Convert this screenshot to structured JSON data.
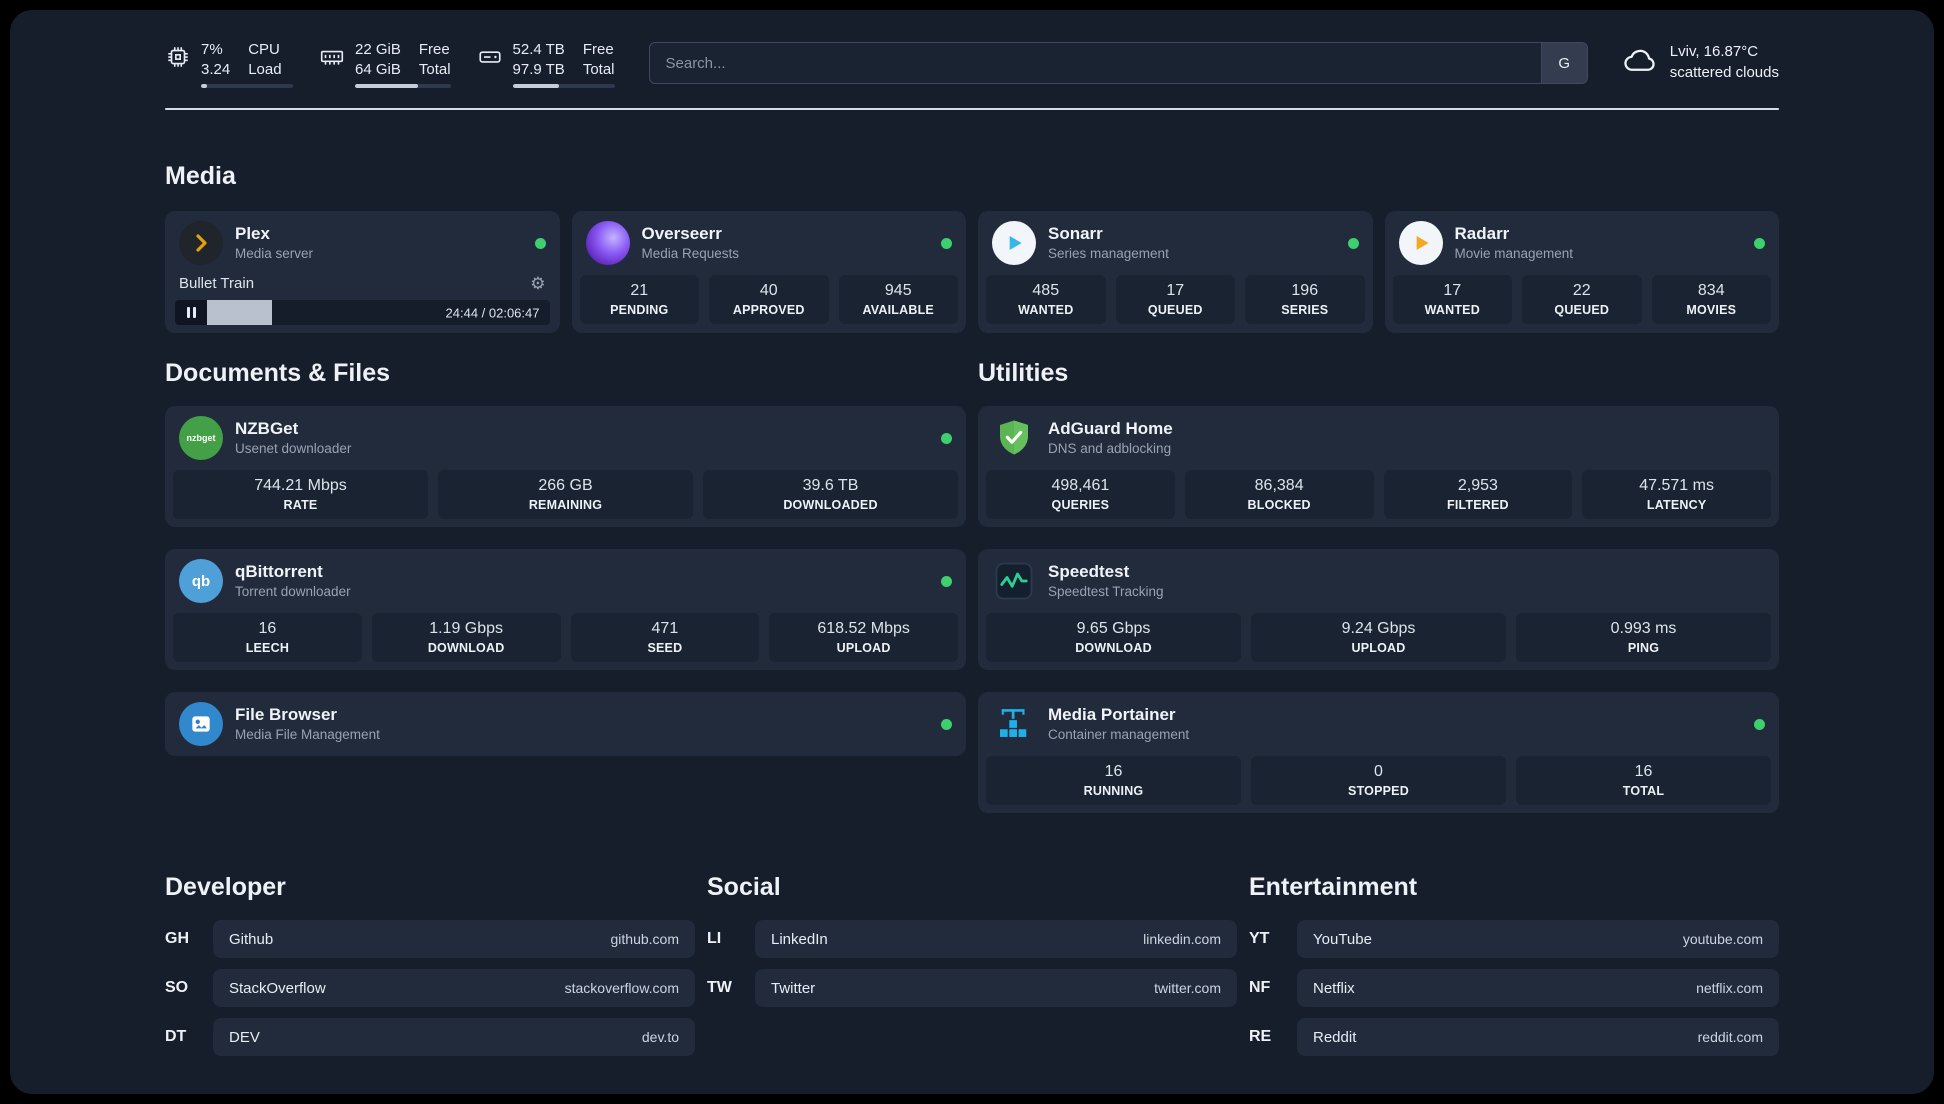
{
  "topbar": {
    "cpu": {
      "value_top": "7%",
      "value_bottom": "3.24",
      "label_top": "CPU",
      "label_bottom": "Load",
      "progress": 7
    },
    "ram": {
      "value_top": "22 GiB",
      "value_bottom": "64 GiB",
      "label_top": "Free",
      "label_bottom": "Total",
      "progress": 66
    },
    "disk": {
      "value_top": "52.4 TB",
      "value_bottom": "97.9 TB",
      "label_top": "Free",
      "label_bottom": "Total",
      "progress": 46
    },
    "search": {
      "placeholder": "Search...",
      "engine_label": "G"
    },
    "weather": {
      "location": "Lviv, 16.87°C",
      "condition": "scattered clouds"
    }
  },
  "media": {
    "title": "Media",
    "plex": {
      "name": "Plex",
      "subtitle": "Media server",
      "now_playing": "Bullet Train",
      "time": "24:44 / 02:06:47",
      "progress": 19
    },
    "overseerr": {
      "name": "Overseerr",
      "subtitle": "Media Requests",
      "stats": [
        {
          "value": "21",
          "label": "PENDING"
        },
        {
          "value": "40",
          "label": "APPROVED"
        },
        {
          "value": "945",
          "label": "AVAILABLE"
        }
      ]
    },
    "sonarr": {
      "name": "Sonarr",
      "subtitle": "Series management",
      "stats": [
        {
          "value": "485",
          "label": "WANTED"
        },
        {
          "value": "17",
          "label": "QUEUED"
        },
        {
          "value": "196",
          "label": "SERIES"
        }
      ]
    },
    "radarr": {
      "name": "Radarr",
      "subtitle": "Movie management",
      "stats": [
        {
          "value": "17",
          "label": "WANTED"
        },
        {
          "value": "22",
          "label": "QUEUED"
        },
        {
          "value": "834",
          "label": "MOVIES"
        }
      ]
    }
  },
  "documents": {
    "title": "Documents & Files",
    "nzbget": {
      "name": "NZBGet",
      "subtitle": "Usenet downloader",
      "icon_text": "nzbget",
      "stats": [
        {
          "value": "744.21 Mbps",
          "label": "RATE"
        },
        {
          "value": "266 GB",
          "label": "REMAINING"
        },
        {
          "value": "39.6 TB",
          "label": "DOWNLOADED"
        }
      ]
    },
    "qbittorrent": {
      "name": "qBittorrent",
      "subtitle": "Torrent downloader",
      "icon_text": "qb",
      "stats": [
        {
          "value": "16",
          "label": "LEECH"
        },
        {
          "value": "1.19 Gbps",
          "label": "DOWNLOAD"
        },
        {
          "value": "471",
          "label": "SEED"
        },
        {
          "value": "618.52 Mbps",
          "label": "UPLOAD"
        }
      ]
    },
    "filebrowser": {
      "name": "File Browser",
      "subtitle": "Media File Management"
    }
  },
  "utilities": {
    "title": "Utilities",
    "adguard": {
      "name": "AdGuard Home",
      "subtitle": "DNS and adblocking",
      "stats": [
        {
          "value": "498,461",
          "label": "QUERIES"
        },
        {
          "value": "86,384",
          "label": "BLOCKED"
        },
        {
          "value": "2,953",
          "label": "FILTERED"
        },
        {
          "value": "47.571 ms",
          "label": "LATENCY"
        }
      ]
    },
    "speedtest": {
      "name": "Speedtest",
      "subtitle": "Speedtest Tracking",
      "stats": [
        {
          "value": "9.65 Gbps",
          "label": "DOWNLOAD"
        },
        {
          "value": "9.24 Gbps",
          "label": "UPLOAD"
        },
        {
          "value": "0.993 ms",
          "label": "PING"
        }
      ]
    },
    "portainer": {
      "name": "Media Portainer",
      "subtitle": "Container management",
      "stats": [
        {
          "value": "16",
          "label": "RUNNING"
        },
        {
          "value": "0",
          "label": "STOPPED"
        },
        {
          "value": "16",
          "label": "TOTAL"
        }
      ]
    }
  },
  "bookmarks": {
    "developer": {
      "title": "Developer",
      "items": [
        {
          "abbr": "GH",
          "name": "Github",
          "url": "github.com"
        },
        {
          "abbr": "SO",
          "name": "StackOverflow",
          "url": "stackoverflow.com"
        },
        {
          "abbr": "DT",
          "name": "DEV",
          "url": "dev.to"
        }
      ]
    },
    "social": {
      "title": "Social",
      "items": [
        {
          "abbr": "LI",
          "name": "LinkedIn",
          "url": "linkedin.com"
        },
        {
          "abbr": "TW",
          "name": "Twitter",
          "url": "twitter.com"
        }
      ]
    },
    "entertainment": {
      "title": "Entertainment",
      "items": [
        {
          "abbr": "YT",
          "name": "YouTube",
          "url": "youtube.com"
        },
        {
          "abbr": "NF",
          "name": "Netflix",
          "url": "netflix.com"
        },
        {
          "abbr": "RE",
          "name": "Reddit",
          "url": "reddit.com"
        }
      ]
    }
  },
  "colors": {
    "status_online": "#3ecf6f",
    "accent_plex": "#e5a00d",
    "accent_sonarr": "#38b6e8",
    "accent_radarr": "#f6a821",
    "accent_adguard": "#5ab552",
    "accent_speedtest": "#2ecf94",
    "accent_portainer": "#1fb0e8"
  }
}
